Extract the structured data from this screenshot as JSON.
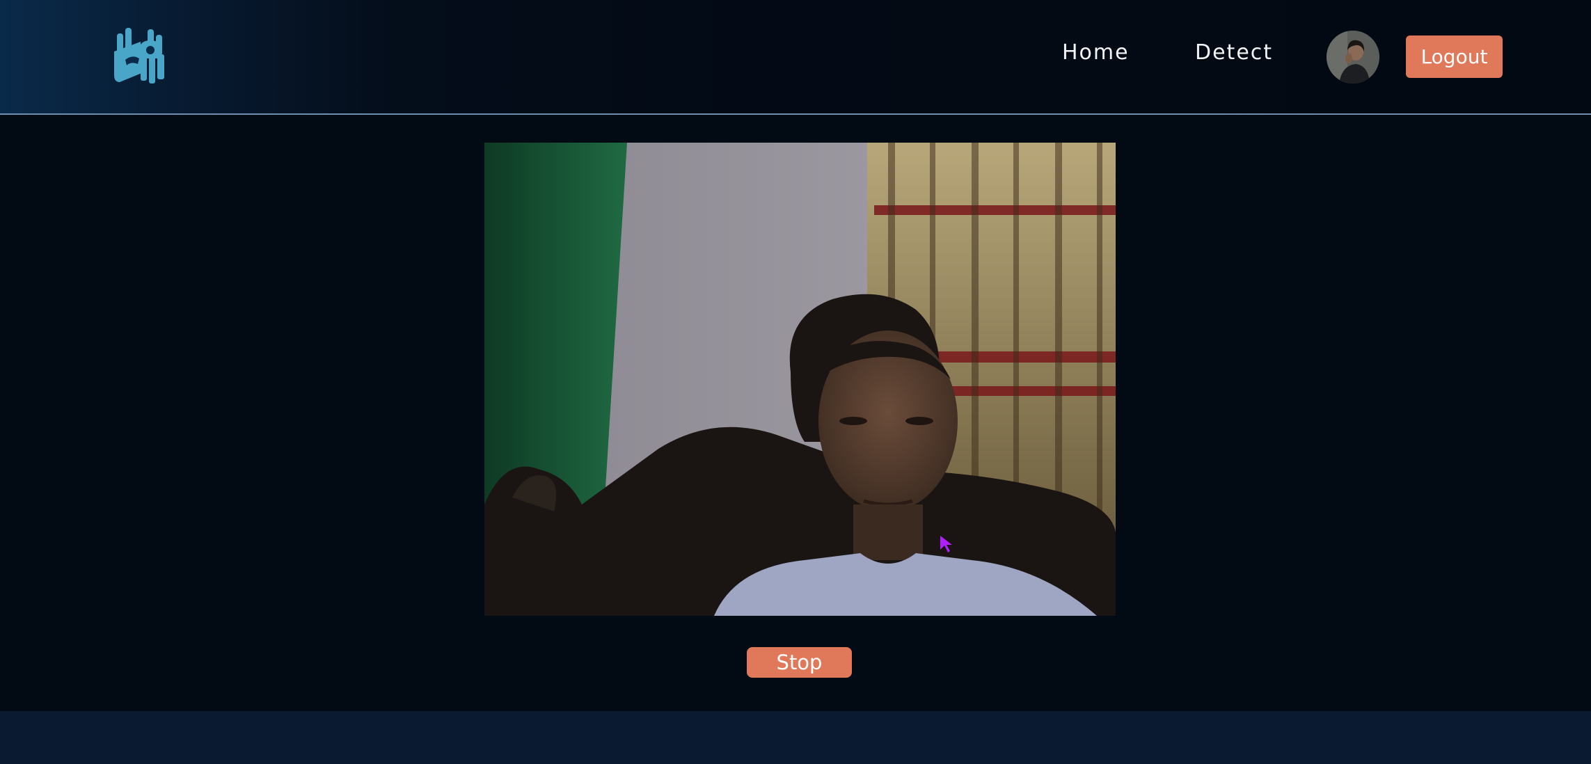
{
  "header": {
    "logo_icon": "hand-sign-logo-icon",
    "nav": {
      "home_label": "Home",
      "detect_label": "Detect"
    },
    "avatar_icon": "user-avatar",
    "logout_label": "Logout"
  },
  "main": {
    "video_feed_icon": "webcam-feed",
    "stop_label": "Stop"
  },
  "colors": {
    "accent": "#e0785a",
    "background": "#020a14",
    "header_gradient_start": "#0a2a4a",
    "footer": "#0a1a30",
    "logo": "#4aa6c8"
  }
}
